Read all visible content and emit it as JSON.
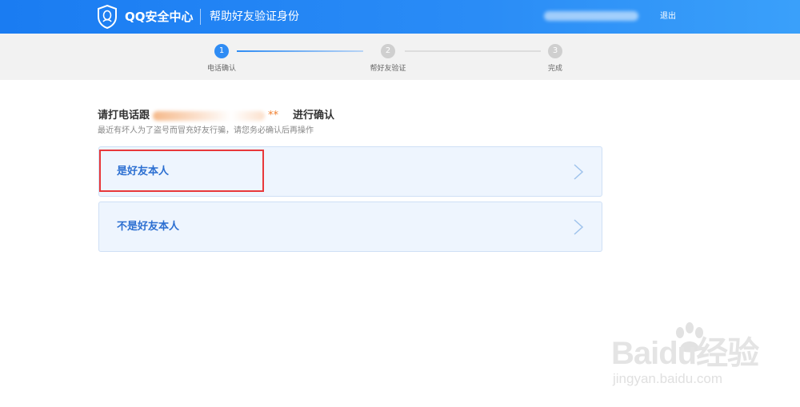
{
  "header": {
    "brand": "QQ安全中心",
    "subtitle": "帮助好友验证身份",
    "logout": "退出"
  },
  "steps": [
    {
      "number": "1",
      "label": "电话确认",
      "state": "active"
    },
    {
      "number": "2",
      "label": "帮好友验证",
      "state": "inactive"
    },
    {
      "number": "3",
      "label": "完成",
      "state": "inactive"
    }
  ],
  "main": {
    "title_prefix": "请打电话跟",
    "title_stars": "**",
    "title_suffix": "进行确认",
    "subtitle": "最近有坏人为了盗号而冒充好友行骗，请您务必确认后再操作",
    "options": [
      {
        "label": "是好友本人"
      },
      {
        "label": "不是好友本人"
      }
    ]
  },
  "watermark": {
    "brand": "Baidu经验",
    "url": "jingyan.baidu.com"
  },
  "colors": {
    "header": "#1a7cf2",
    "accent": "#2f8cf4",
    "option_bg": "#eef5fe",
    "option_text": "#2c6fd1",
    "highlight": "#e8383a"
  }
}
